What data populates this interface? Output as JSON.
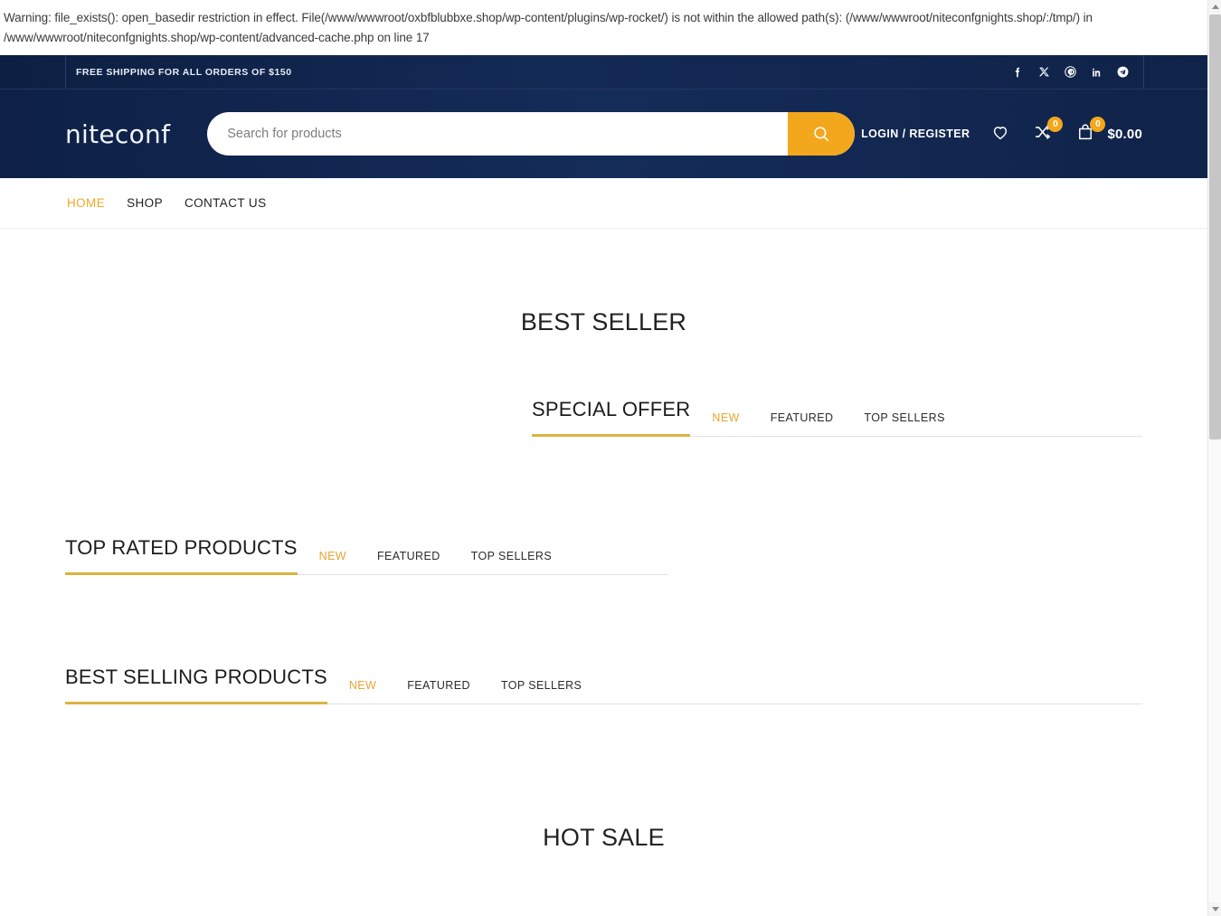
{
  "php_warning": {
    "line1": "Warning: file_exists(): open_basedir restriction in effect. File(/www/wwwroot/oxbfblubbxe.shop/wp-content/plugins/wp-rocket/) is not within the allowed path(s): (/www/wwwroot/niteconfgnights.shop/:/tmp/) in",
    "line2": "/www/wwwroot/niteconfgnights.shop/wp-content/advanced-cache.php on line 17"
  },
  "topbar": {
    "message": "FREE SHIPPING FOR ALL ORDERS OF $150",
    "socials": [
      {
        "name": "facebook-icon",
        "label": "Facebook"
      },
      {
        "name": "x-twitter-icon",
        "label": "X"
      },
      {
        "name": "pinterest-icon",
        "label": "Pinterest"
      },
      {
        "name": "linkedin-icon",
        "label": "LinkedIn"
      },
      {
        "name": "telegram-icon",
        "label": "Telegram"
      }
    ]
  },
  "header": {
    "logo": "niteconf",
    "search": {
      "placeholder": "Search for products",
      "value": "",
      "button_icon": "search-icon"
    },
    "login_label": "LOGIN / REGISTER",
    "wishlist_icon": "heart-icon",
    "compare_icon": "compare-shuffle-icon",
    "compare_count": "0",
    "cart_icon": "shopping-bag-icon",
    "cart_count": "0",
    "cart_total": "$0.00"
  },
  "nav": {
    "items": [
      {
        "label": "HOME",
        "active": true
      },
      {
        "label": "SHOP",
        "active": false
      },
      {
        "label": "CONTACT US",
        "active": false
      }
    ]
  },
  "content": {
    "best_seller_title": "BEST SELLER",
    "hot_sale_title": "HOT SALE",
    "sections": [
      {
        "title": "SPECIAL OFFER",
        "tabs": [
          {
            "label": "NEW",
            "active": true
          },
          {
            "label": "FEATURED",
            "active": false
          },
          {
            "label": "TOP SELLERS",
            "active": false
          }
        ]
      },
      {
        "title": "TOP RATED PRODUCTS",
        "tabs": [
          {
            "label": "NEW",
            "active": true
          },
          {
            "label": "FEATURED",
            "active": false
          },
          {
            "label": "TOP SELLERS",
            "active": false
          }
        ]
      },
      {
        "title": "BEST SELLING PRODUCTS",
        "tabs": [
          {
            "label": "NEW",
            "active": true
          },
          {
            "label": "FEATURED",
            "active": false
          },
          {
            "label": "TOP SELLERS",
            "active": false
          }
        ]
      }
    ]
  },
  "colors": {
    "header_navy": "#102349",
    "accent_amber": "#f3a71c",
    "tab_active": "#e9a530",
    "underline_gold": "#d9b440"
  }
}
